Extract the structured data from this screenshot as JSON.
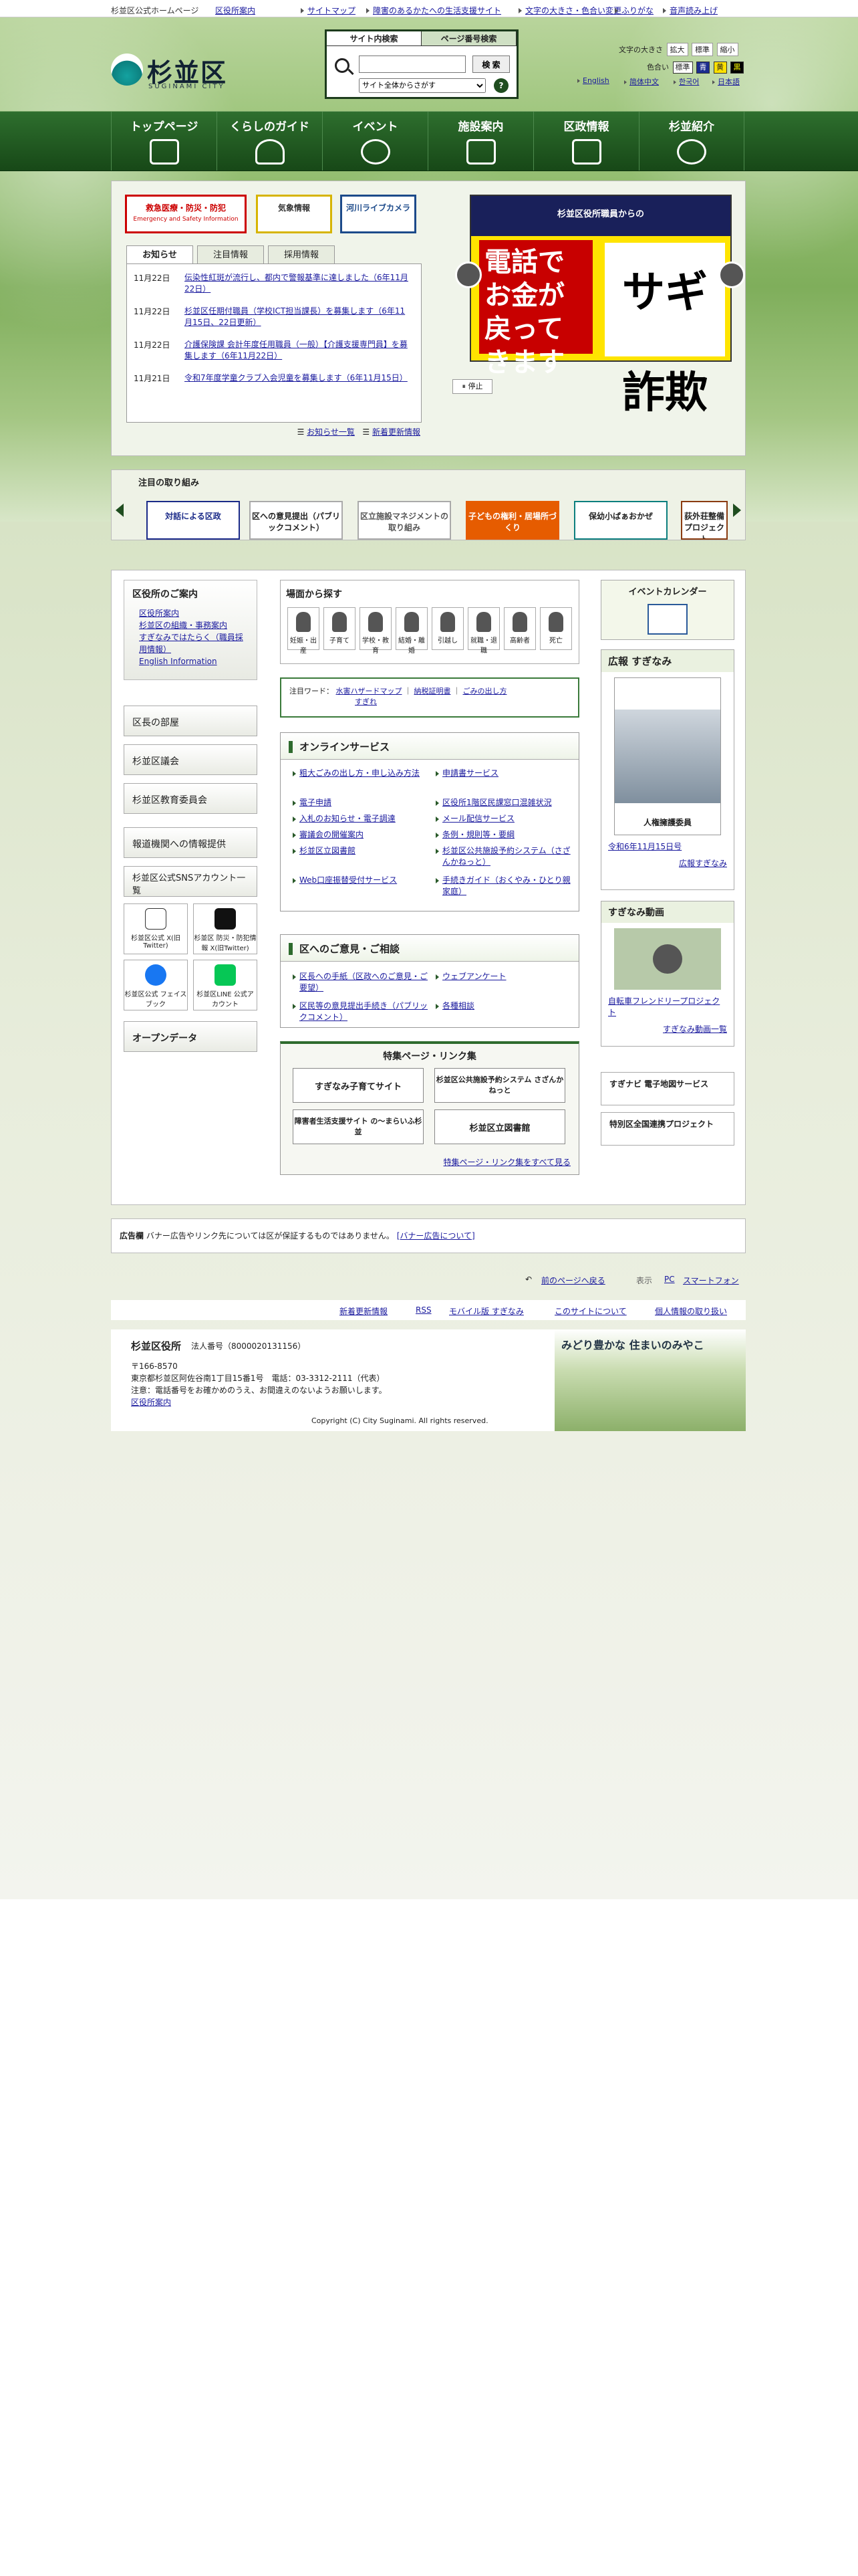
{
  "util": {
    "home_label": "杉並区公式ホームページ",
    "office_link": "区役所案内",
    "links": [
      "サイトマップ",
      "障害のあるかたへの生活支援サイト",
      "文字の大きさ・色合い変更",
      "ふりがな",
      "音声読み上げ"
    ]
  },
  "header": {
    "logo_name": "杉並区",
    "logo_sub": "SUGINAMI CITY",
    "search_tabs": [
      "サイト内検索",
      "ページ番号検索"
    ],
    "search_button": "検 索",
    "search_select": "サイト全体からさがす",
    "help": "?",
    "font_size_label": "文字の大きさ",
    "font_sizes": [
      "拡大",
      "標準",
      "縮小"
    ],
    "color_label": "色合い",
    "colors": [
      "標準",
      "青",
      "黄",
      "黒"
    ],
    "langs": [
      "English",
      "简体中文",
      "한국어",
      "日本語"
    ]
  },
  "gnav": [
    "トップページ",
    "くらしのガイド",
    "イベント",
    "施設案内",
    "区政情報",
    "杉並紹介"
  ],
  "emergency": [
    "救急医療・防災・防犯",
    "気象情報",
    "河川ライブカメラ"
  ],
  "emergency_sub": "Emergency and Safety Information",
  "news": {
    "tabs": [
      "お知らせ",
      "注目情報",
      "採用情報"
    ],
    "items": [
      {
        "date": "11月22日",
        "title": "伝染性紅斑が流行し、都内で警報基準に達しました（6年11月22日）"
      },
      {
        "date": "11月22日",
        "title": "杉並区任期付職員（学校ICT担当課長）を募集します（6年11月15日、22日更新）"
      },
      {
        "date": "11月22日",
        "title": "介護保険課 会計年度任用職員（一般）【介護支援専門員】を募集します（6年11月22日）"
      },
      {
        "date": "11月21日",
        "title": "令和7年度学童クラブ入会児童を募集します（6年11月15日）"
      }
    ],
    "list_link": "お知らせ一覧",
    "rss_link": "新着更新情報"
  },
  "slider": {
    "header": "杉並区役所職員からの",
    "text_big": "電話でお金が戻ってきます",
    "text_side": "サギ 詐欺",
    "pause": "停止"
  },
  "focus": {
    "title": "注目の取り組み",
    "items": [
      "対話による区政",
      "区への意見提出（パブリックコメント）",
      "区立施設マネジメントの取り組み",
      "子どもの権利・居場所づくり",
      "保幼小ぱぁおかぜ",
      "荻外荘整備プロジェクト"
    ]
  },
  "left": {
    "guide_title": "区役所のご案内",
    "guide_links": [
      "区役所案内",
      "杉並区の組織・事務案内",
      "すぎなみではたらく（職員採用情報）",
      "English Information"
    ],
    "buttons": [
      "区長の部屋",
      "杉並区議会",
      "杉並区教育委員会",
      "報道機関への情報提供",
      "杉並区公式SNSアカウント一覧"
    ],
    "sns": [
      "杉並区公式 X(旧Twitter)",
      "杉並区 防災・防犯情報 X(旧Twitter)",
      "杉並区公式 フェイスブック",
      "杉並区LINE 公式アカウント"
    ],
    "open_data": "オープンデータ"
  },
  "categories": {
    "title": "場面から探す",
    "items": [
      "妊娠・出産",
      "子育て",
      "学校・教育",
      "結婚・離婚",
      "引越し",
      "就職・退職",
      "高齢者",
      "死亡"
    ]
  },
  "attention": {
    "label": "注目ワード：",
    "words": [
      "水害ハザードマップ",
      "納税証明書",
      "ごみの出し方",
      "すぎれ"
    ]
  },
  "online": {
    "title": "オンラインサービス",
    "left": [
      "粗大ごみの出し方・申し込み方法",
      "電子申請",
      "入札のお知らせ・電子調達",
      "審議会の開催案内",
      "杉並区立図書館",
      "Web口座振替受付サービス"
    ],
    "right": [
      "申請書サービス",
      "区役所1階区民課窓口混雑状況",
      "メール配信サービス",
      "条例・規則等・要綱",
      "杉並区公共施設予約システム（さざんかねっと）",
      "手続きガイド（おくやみ・ひとり親家庭）"
    ]
  },
  "opinion": {
    "title": "区へのご意見・ご相談",
    "left": [
      "区長への手紙（区政へのご意見・ご要望）",
      "区民等の意見提出手続き（パブリックコメント）"
    ],
    "right": [
      "ウェブアンケート",
      "各種相談"
    ]
  },
  "feature": {
    "title": "特集ページ・リンク集",
    "items": [
      "すぎなみ子育てサイト",
      "杉並区公共施設予約システム さざんかねっと",
      "障害者生活支援サイト の〜まらいふ杉並",
      "杉並区立図書館"
    ],
    "all_link": "特集ページ・リンク集をすべて見る"
  },
  "right": {
    "calendar": "イベントカレンダー",
    "kouhou_title": "広報 すぎなみ",
    "kouhou_date": "令和6年11月15日号",
    "kouhou_cover": "人権擁護委員",
    "kouhou_link": "広報すぎなみ",
    "video_title": "すぎなみ動画",
    "video_caption": "自転車フレンドリープロジェクト",
    "video_link": "すぎなみ動画一覧",
    "navi": "すぎナビ 電子地図サービス",
    "special": "特別区全国連携プロジェクト"
  },
  "ad": {
    "label": "広告欄",
    "text": "バナー広告やリンク先については区が保証するものではありません。",
    "link": "[バナー広告について]"
  },
  "pagefoot": {
    "back": "前のページへ戻る",
    "display_label": "表示",
    "modes": [
      "PC",
      "スマートフォン"
    ]
  },
  "sitelinks": [
    "新着更新情報",
    "RSS",
    "モバイル版 すぎなみ",
    "このサイトについて",
    "個人情報の取り扱い"
  ],
  "footer": {
    "org": "杉並区役所",
    "corp_no": "法人番号（8000020131156）",
    "zip": "〒166-8570",
    "address": "東京都杉並区阿佐谷南1丁目15番1号　電話：03-3312-2111（代表）",
    "notice": "注意：電話番号をお確かめのうえ、お間違えのないようお願いします。",
    "office_link": "区役所案内",
    "copyright": "Copyright (C) City Suginami. All rights reserved.",
    "catch": "みどり豊かな 住まいのみやこ"
  }
}
